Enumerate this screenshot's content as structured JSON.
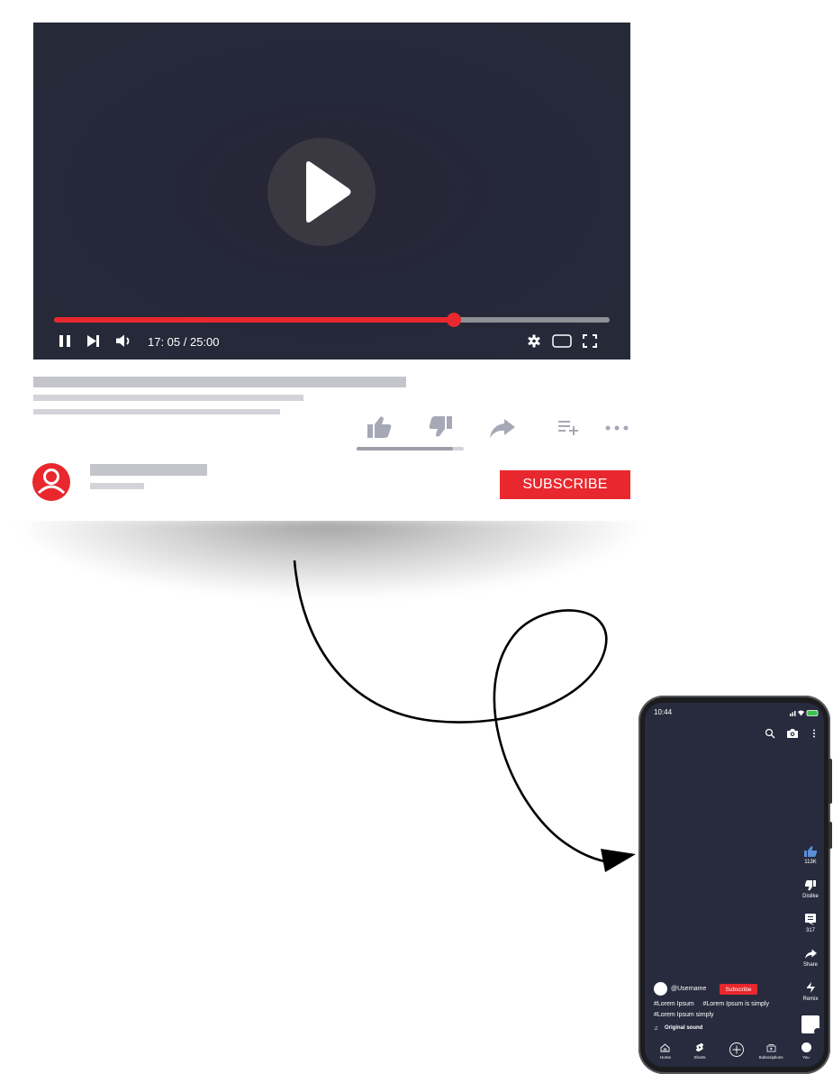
{
  "player": {
    "time": "17: 05 / 25:00",
    "progress_fraction": 0.72,
    "accent": "#e8282e"
  },
  "channel": {
    "subscribe_label": "SUBSCRIBE"
  },
  "like_ratio": 0.9,
  "phone": {
    "status_time": "10:44",
    "likes": "113K",
    "dislike_label": "Dislike",
    "comments": "317",
    "share_label": "Share",
    "remix_label": "Remix",
    "username": "@Username",
    "subscribe_label": "Subscribe",
    "hashtags_line1": "#Lorem Ipsum     #Lorem Ipsum is simply",
    "hashtags_line2": "#Lorem Ipsum simply",
    "sound": "Original sound",
    "nav": [
      "Home",
      "Shorts",
      "Subscriptions",
      "You"
    ]
  },
  "icons": {
    "play": "play-icon",
    "pause": "pause-icon",
    "next": "skip-next-icon",
    "volume": "volume-icon",
    "settings": "gear-icon",
    "miniplayer": "miniplayer-icon",
    "fullscreen": "fullscreen-icon",
    "like": "thumbs-up-icon",
    "dislike": "thumbs-down-icon",
    "share": "share-icon",
    "playlist": "add-to-playlist-icon",
    "more": "more-horizontal-icon",
    "avatar": "user-avatar-icon"
  }
}
